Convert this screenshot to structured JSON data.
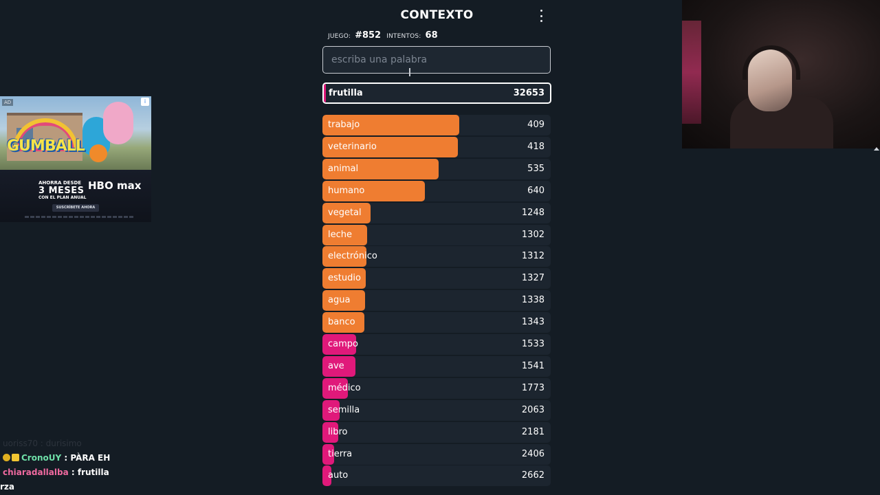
{
  "game": {
    "title": "CONTEXTO",
    "menu_icon": "more-vertical-icon",
    "stats": {
      "game_label": "JUEGO:",
      "game_value": "#852",
      "attempts_label": "INTENTOS:",
      "attempts_value": "68"
    },
    "input": {
      "placeholder": "escriba una palabra",
      "value": ""
    },
    "current_guess": {
      "word": "frutilla",
      "distance": "32653",
      "color": "#e0197a",
      "fill_fraction": 0.006
    },
    "colors": {
      "near": "#ef7d31",
      "mid": "#e0197a",
      "track": "#1c252f"
    },
    "guesses": [
      {
        "word": "trabajo",
        "distance": "409",
        "color": "#ef7d31",
        "fill_fraction": 0.6
      },
      {
        "word": "veterinario",
        "distance": "418",
        "color": "#ef7d31",
        "fill_fraction": 0.593
      },
      {
        "word": "animal",
        "distance": "535",
        "color": "#ef7d31",
        "fill_fraction": 0.51
      },
      {
        "word": "humano",
        "distance": "640",
        "color": "#ef7d31",
        "fill_fraction": 0.45
      },
      {
        "word": "vegetal",
        "distance": "1248",
        "color": "#ef7d31",
        "fill_fraction": 0.21
      },
      {
        "word": "leche",
        "distance": "1302",
        "color": "#ef7d31",
        "fill_fraction": 0.195
      },
      {
        "word": "electrónico",
        "distance": "1312",
        "color": "#ef7d31",
        "fill_fraction": 0.193
      },
      {
        "word": "estudio",
        "distance": "1327",
        "color": "#ef7d31",
        "fill_fraction": 0.19
      },
      {
        "word": "agua",
        "distance": "1338",
        "color": "#ef7d31",
        "fill_fraction": 0.188
      },
      {
        "word": "banco",
        "distance": "1343",
        "color": "#ef7d31",
        "fill_fraction": 0.185
      },
      {
        "word": "campo",
        "distance": "1533",
        "color": "#e0197a",
        "fill_fraction": 0.148
      },
      {
        "word": "ave",
        "distance": "1541",
        "color": "#e0197a",
        "fill_fraction": 0.145
      },
      {
        "word": "médico",
        "distance": "1773",
        "color": "#e0197a",
        "fill_fraction": 0.11
      },
      {
        "word": "semilla",
        "distance": "2063",
        "color": "#e0197a",
        "fill_fraction": 0.075
      },
      {
        "word": "libro",
        "distance": "2181",
        "color": "#e0197a",
        "fill_fraction": 0.068
      },
      {
        "word": "tierra",
        "distance": "2406",
        "color": "#e0197a",
        "fill_fraction": 0.05
      },
      {
        "word": "auto",
        "distance": "2662",
        "color": "#e0197a",
        "fill_fraction": 0.038
      }
    ]
  },
  "ad": {
    "badge": "AD",
    "info_icon": "ad-info-icon",
    "show_logo": "GUMBALL",
    "promo_line1": "AHORRA DESDE",
    "promo_line2": "3 MESES",
    "promo_line3": "CON EL PLAN ANUAL",
    "brand": "HBO max",
    "cta": "SUSCRÍBETE AHORA"
  },
  "chat": {
    "faded_line": "uoriss70 : durisimo",
    "messages": [
      {
        "user": "CronoUY",
        "sep": " : ",
        "text": "PÀRA EH"
      },
      {
        "user": "chiaradallalba",
        "sep": " : ",
        "text": "frutilla"
      }
    ],
    "partial_line": "rza"
  }
}
